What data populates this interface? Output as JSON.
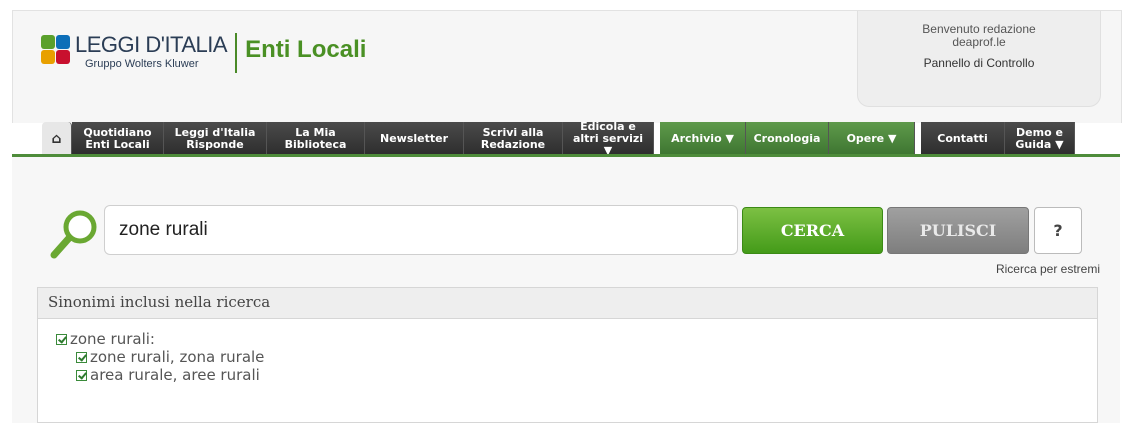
{
  "header": {
    "brand_title": "LEGGI D'ITALIA",
    "brand_subtitle": "Gruppo Wolters Kluwer",
    "product": "Enti Locali"
  },
  "welcome": {
    "line1": "Benvenuto redazione",
    "line2": "deaprof.le",
    "control_panel": "Pannello di Controllo"
  },
  "nav": {
    "home_icon": "home-icon",
    "items": [
      {
        "label": "Quotidiano\nEnti Locali"
      },
      {
        "label": "Leggi d'Italia\nRisponde"
      },
      {
        "label": "La Mia\nBiblioteca"
      },
      {
        "label": "Newsletter"
      },
      {
        "label": "Scrivi alla\nRedazione"
      },
      {
        "label": "Edicola e\naltri servizi\n▼"
      }
    ],
    "green_items": [
      {
        "label": "Archivio ▼"
      },
      {
        "label": "Cronologia"
      },
      {
        "label": "Opere ▼"
      }
    ],
    "right_items": [
      {
        "label": "Contatti"
      },
      {
        "label": "Demo e\nGuida ▼"
      }
    ]
  },
  "search": {
    "value": "zone rurali",
    "cerca_label": "CERCA",
    "pulisci_label": "PULISCI",
    "help_label": "?",
    "estremi_link": "Ricerca per estremi"
  },
  "synonyms": {
    "heading": "Sinonimi inclusi nella ricerca",
    "root": "zone rurali:",
    "items": [
      "zone rurali, zona rurale",
      "area rurale, aree rurali"
    ]
  },
  "colors": {
    "accent_green": "#4a9024",
    "nav_dark": "#3a3a3a"
  }
}
